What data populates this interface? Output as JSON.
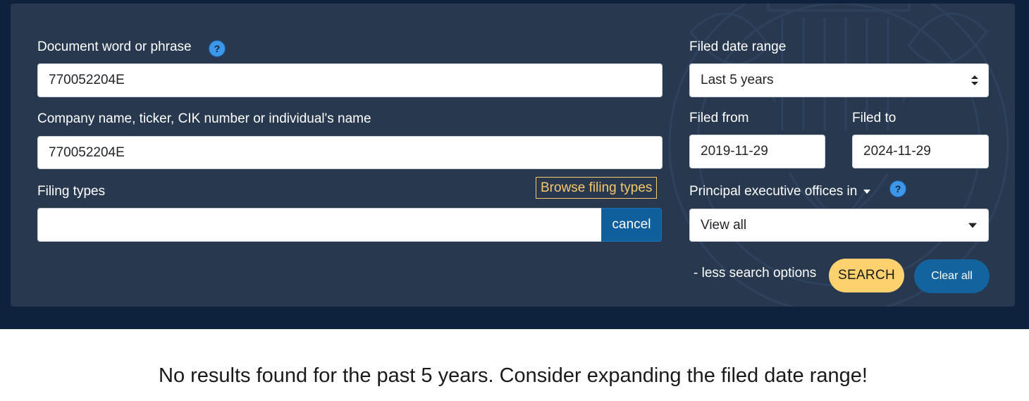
{
  "search_form": {
    "document_phrase": {
      "label": "Document word or phrase",
      "help_icon": "?",
      "value": "770052204E"
    },
    "company": {
      "label": "Company name, ticker, CIK number or individual's name",
      "value": "770052204E"
    },
    "filing_types": {
      "label": "Filing types",
      "browse_link": "Browse filing types",
      "value": "",
      "cancel_label": "cancel"
    },
    "date_range": {
      "label": "Filed date range",
      "selected": "Last 5 years"
    },
    "filed_from": {
      "label": "Filed from",
      "value": "2019-11-29"
    },
    "filed_to": {
      "label": "Filed to",
      "value": "2024-11-29"
    },
    "location": {
      "label": "Principal executive offices in",
      "help_icon": "?",
      "selected": "View all"
    },
    "less_options": "- less search options",
    "search_button": "SEARCH",
    "clear_button": "Clear all"
  },
  "results": {
    "message": "No results found for the past 5 years. Consider expanding the filed date range!"
  },
  "colors": {
    "hero_bg": "#0f223d",
    "panel_bg": "#28384f",
    "search_button": "#fdd26e",
    "clear_button": "#12639e",
    "help_icon": "#3d97e8",
    "browse_link": "#f5c96b"
  }
}
